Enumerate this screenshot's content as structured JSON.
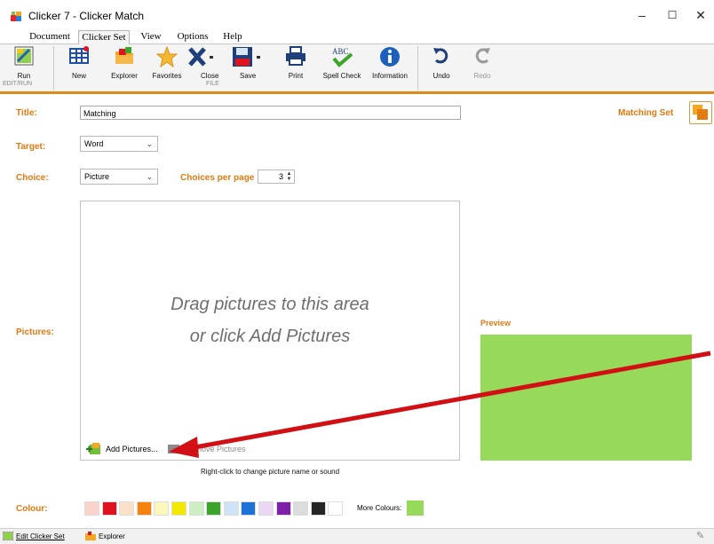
{
  "window": {
    "title": "Clicker 7 - Clicker Match",
    "min": "–",
    "max": "☐",
    "close": "✕"
  },
  "menu": {
    "tabs": [
      "Document",
      "Clicker Set",
      "View",
      "Options",
      "Help"
    ],
    "active": "Clicker Set"
  },
  "ribbon": {
    "run": "Run",
    "new": "New",
    "explorer": "Explorer",
    "favorites": "Favorites",
    "close": "Close",
    "save": "Save",
    "print": "Print",
    "spell_check": "Spell Check",
    "information": "Information",
    "undo": "Undo",
    "redo": "Redo",
    "group_edit_run": "EDIT/RUN",
    "group_file": "FILE"
  },
  "form": {
    "title_label": "Title:",
    "title_value": "Matching",
    "target_label": "Target:",
    "target_value": "Word",
    "choice_label": "Choice:",
    "choice_value": "Picture",
    "choices_per_page_label": "Choices per page",
    "choices_per_page_value": "3",
    "pictures_label": "Pictures:",
    "drop_line1": "Drag pictures to this area",
    "drop_line2": "or click Add Pictures",
    "add_pictures": "Add Pictures...",
    "remove_pictures": "Remove Pictures",
    "hint": "Right-click to change picture name or sound",
    "preview_label": "Preview",
    "colour_label": "Colour:",
    "more_colours": "More Colours:",
    "matching_set": "Matching Set"
  },
  "colours": {
    "swatches": [
      "#f9d3cc",
      "#e0121d",
      "#fbe0c8",
      "#f5820f",
      "#fcf7bd",
      "#f5e800",
      "#cdeec3",
      "#3aa52a",
      "#cfe3f7",
      "#1d72d8",
      "#ead7f3",
      "#7f1fa8",
      "#dcdcdc",
      "#262626",
      "#ffffff"
    ],
    "preview": "#96d95b",
    "accent": "#e07a10"
  },
  "statusbar": {
    "edit": "Edit Clicker Set",
    "explorer": "Explorer"
  }
}
